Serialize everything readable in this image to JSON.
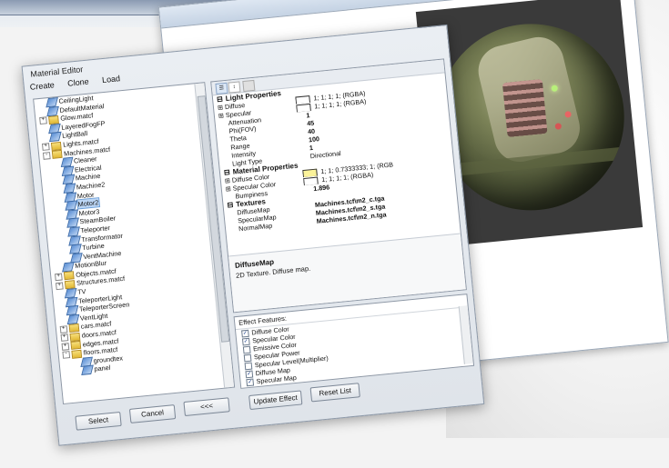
{
  "editor": {
    "title": "Material Editor",
    "menu": [
      "Create",
      "Clone",
      "Load"
    ],
    "buttons": {
      "select": "Select",
      "cancel": "Cancel",
      "back": "<<<",
      "update_effect": "Update Effect",
      "reset_list": "Reset List"
    }
  },
  "tree": {
    "items": [
      {
        "label": "CeilingLight",
        "type": "mat",
        "indent": 1
      },
      {
        "label": "DefaultMaterial",
        "type": "mat",
        "indent": 1
      },
      {
        "label": "Glow.matcf",
        "type": "folder",
        "indent": 0,
        "exp": "+"
      },
      {
        "label": "LayeredFogFP",
        "type": "mat",
        "indent": 1
      },
      {
        "label": "LightBall",
        "type": "mat",
        "indent": 1
      },
      {
        "label": "Lights.matcf",
        "type": "folder",
        "indent": 0,
        "exp": "+"
      },
      {
        "label": "Machines.matcf",
        "type": "folder",
        "indent": 0,
        "exp": "-"
      },
      {
        "label": "Cleaner",
        "type": "mat",
        "indent": 2
      },
      {
        "label": "Electrical",
        "type": "mat",
        "indent": 2
      },
      {
        "label": "Machine",
        "type": "mat",
        "indent": 2
      },
      {
        "label": "Machine2",
        "type": "mat",
        "indent": 2
      },
      {
        "label": "Motor",
        "type": "mat",
        "indent": 2
      },
      {
        "label": "Motor2",
        "type": "mat",
        "indent": 2,
        "selected": true
      },
      {
        "label": "Motor3",
        "type": "mat",
        "indent": 2
      },
      {
        "label": "SteamBoiler",
        "type": "mat",
        "indent": 2
      },
      {
        "label": "Teleporter",
        "type": "mat",
        "indent": 2
      },
      {
        "label": "Transformator",
        "type": "mat",
        "indent": 2
      },
      {
        "label": "Turbine",
        "type": "mat",
        "indent": 2
      },
      {
        "label": "VentMachine",
        "type": "mat",
        "indent": 2
      },
      {
        "label": "MotionBlur",
        "type": "mat",
        "indent": 1
      },
      {
        "label": "Objects.matcf",
        "type": "folder",
        "indent": 0,
        "exp": "+"
      },
      {
        "label": "Structures.matcf",
        "type": "folder",
        "indent": 0,
        "exp": "+"
      },
      {
        "label": "TV",
        "type": "mat",
        "indent": 1
      },
      {
        "label": "TeleporterLight",
        "type": "mat",
        "indent": 1
      },
      {
        "label": "TeleporterScreen",
        "type": "mat",
        "indent": 1
      },
      {
        "label": "VentLight",
        "type": "mat",
        "indent": 1
      },
      {
        "label": "cars.matcf",
        "type": "folder",
        "indent": 0,
        "exp": "+"
      },
      {
        "label": "doors.matcf",
        "type": "folder",
        "indent": 0,
        "exp": "+"
      },
      {
        "label": "edges.matcf",
        "type": "folder",
        "indent": 0,
        "exp": "+"
      },
      {
        "label": "floors.matcf",
        "type": "folder",
        "indent": 0,
        "exp": "-"
      },
      {
        "label": "groundtex",
        "type": "mat",
        "indent": 2
      },
      {
        "label": "panel",
        "type": "mat",
        "indent": 2
      }
    ]
  },
  "props": {
    "categories": [
      {
        "name": "Light Properties",
        "rows": [
          {
            "k": "Diffuse",
            "v": "1; 1; 1; 1; (RGBA)",
            "swatch": "white",
            "exp": "+"
          },
          {
            "k": "Specular",
            "v": "1; 1; 1; 1; (RGBA)",
            "swatch": "white",
            "exp": "+"
          },
          {
            "k": "Attenuation",
            "v": "1"
          },
          {
            "k": "Phi(FOV)",
            "v": "45"
          },
          {
            "k": "Theta",
            "v": "40"
          },
          {
            "k": "Range",
            "v": "100"
          },
          {
            "k": "Intensity",
            "v": "1"
          },
          {
            "k": "Light Type",
            "v": "Directional"
          }
        ]
      },
      {
        "name": "Material Properties",
        "rows": [
          {
            "k": "Diffuse Color",
            "v": "1; 1; 0.7333333; 1; (RGB",
            "swatch": "yellow",
            "exp": "+"
          },
          {
            "k": "Specular Color",
            "v": "1; 1; 1; 1; (RGBA)",
            "swatch": "white",
            "exp": "+"
          },
          {
            "k": "Bumpiness",
            "v": "1.896"
          }
        ]
      },
      {
        "name": "Textures",
        "rows": [
          {
            "k": "DiffuseMap",
            "v": "Machines.tcf\\m2_c.tga"
          },
          {
            "k": "SpecularMap",
            "v": "Machines.tcf\\m2_s.tga"
          },
          {
            "k": "NormalMap",
            "v": "Machines.tcf\\m2_n.tga"
          }
        ]
      }
    ],
    "description_title": "DiffuseMap",
    "description_text": "2D Texture. Diffuse map."
  },
  "effects": {
    "header": "Effect Features:",
    "items": [
      {
        "label": "Diffuse Color",
        "checked": true
      },
      {
        "label": "Specular Color",
        "checked": true
      },
      {
        "label": "Emissive Color",
        "checked": false
      },
      {
        "label": "Specular Power",
        "checked": false
      },
      {
        "label": "Specular Level(Multiplier)",
        "checked": false
      },
      {
        "label": "Diffuse Map",
        "checked": true
      },
      {
        "label": "Specular Map",
        "checked": true
      }
    ]
  },
  "toolbar": {
    "sort_icon": "sort-icon",
    "categorized_icon": "categorized-icon",
    "pages_icon": "property-pages-icon"
  },
  "back_window": {
    "close_label": "x"
  }
}
